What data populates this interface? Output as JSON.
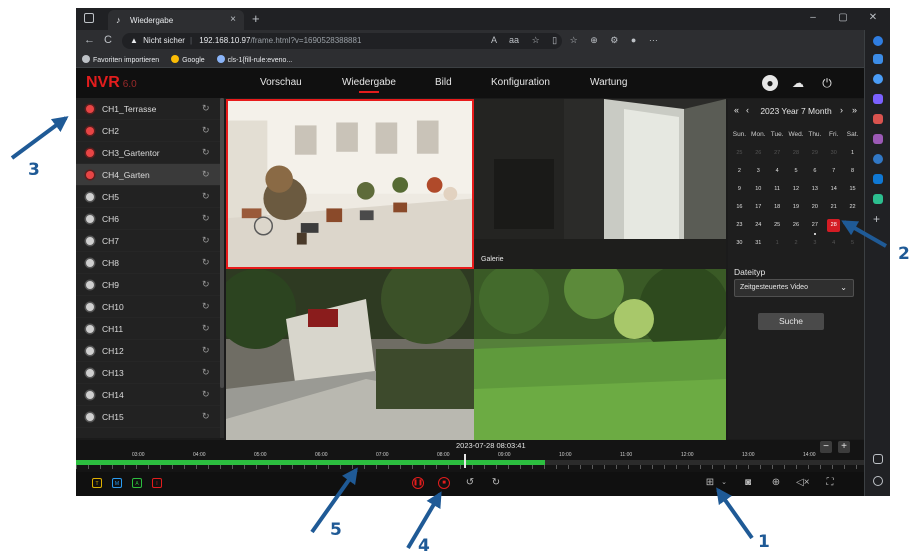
{
  "browser": {
    "tab_title": "Wiedergabe",
    "tab_close": "×",
    "new_tab": "+",
    "window_controls": [
      "–",
      "▢",
      "✕"
    ],
    "nav": [
      "←",
      "C"
    ],
    "security_label": "Nicht sicher",
    "url_host": "192.168.10.97",
    "url_path": "/frame.html?v=1690528388881",
    "icons": [
      "A",
      "aa",
      "☆",
      "▯",
      "☆",
      "⊕",
      "⚙",
      "●",
      "···"
    ],
    "favorites": [
      "Favoriten importieren",
      "Google",
      "cls-1{fill-rule:eveno..."
    ]
  },
  "app": {
    "logo": "NVR",
    "version": "6.0",
    "nav": [
      {
        "label": "Vorschau",
        "active": false
      },
      {
        "label": "Wiedergabe",
        "active": true
      },
      {
        "label": "Bild",
        "active": false
      },
      {
        "label": "Konfiguration",
        "active": false
      },
      {
        "label": "Wartung",
        "active": false
      }
    ],
    "top_icons": [
      "user-icon",
      "cloud-icon",
      "power-icon"
    ]
  },
  "channels": [
    {
      "name": "CH1_Terrasse",
      "recording": true,
      "selected": false
    },
    {
      "name": "CH2",
      "recording": true,
      "selected": false
    },
    {
      "name": "CH3_Gartentor",
      "recording": true,
      "selected": false
    },
    {
      "name": "CH4_Garten",
      "recording": true,
      "selected": true
    },
    {
      "name": "CH5",
      "recording": false,
      "selected": false
    },
    {
      "name": "CH6",
      "recording": false,
      "selected": false
    },
    {
      "name": "CH7",
      "recording": false,
      "selected": false
    },
    {
      "name": "CH8",
      "recording": false,
      "selected": false
    },
    {
      "name": "CH9",
      "recording": false,
      "selected": false
    },
    {
      "name": "CH10",
      "recording": false,
      "selected": false
    },
    {
      "name": "CH11",
      "recording": false,
      "selected": false
    },
    {
      "name": "CH12",
      "recording": false,
      "selected": false
    },
    {
      "name": "CH13",
      "recording": false,
      "selected": false
    },
    {
      "name": "CH14",
      "recording": false,
      "selected": false
    },
    {
      "name": "CH15",
      "recording": false,
      "selected": false
    }
  ],
  "cameras": [
    {
      "label": "",
      "selected": true
    },
    {
      "label": "Galerie",
      "selected": false
    },
    {
      "label": "",
      "selected": false
    },
    {
      "label": "",
      "selected": false
    }
  ],
  "calendar": {
    "nav_prev_year": "«",
    "nav_prev": "‹",
    "nav_next": "›",
    "nav_next_year": "»",
    "header": "2023 Year  7 Month",
    "weekdays": [
      "Sun.",
      "Mon.",
      "Tue.",
      "Wed.",
      "Thu.",
      "Fri.",
      "Sat."
    ],
    "days": [
      {
        "d": "25",
        "muted": true,
        "mark": false,
        "today": false
      },
      {
        "d": "26",
        "muted": true,
        "mark": false,
        "today": false
      },
      {
        "d": "27",
        "muted": true,
        "mark": false,
        "today": false
      },
      {
        "d": "28",
        "muted": true,
        "mark": false,
        "today": false
      },
      {
        "d": "29",
        "muted": true,
        "mark": false,
        "today": false
      },
      {
        "d": "30",
        "muted": true,
        "mark": false,
        "today": false
      },
      {
        "d": "1",
        "muted": false,
        "mark": false,
        "today": false
      },
      {
        "d": "2",
        "muted": false,
        "mark": false,
        "today": false
      },
      {
        "d": "3",
        "muted": false,
        "mark": false,
        "today": false
      },
      {
        "d": "4",
        "muted": false,
        "mark": false,
        "today": false
      },
      {
        "d": "5",
        "muted": false,
        "mark": false,
        "today": false
      },
      {
        "d": "6",
        "muted": false,
        "mark": false,
        "today": false
      },
      {
        "d": "7",
        "muted": false,
        "mark": false,
        "today": false
      },
      {
        "d": "8",
        "muted": false,
        "mark": false,
        "today": false
      },
      {
        "d": "9",
        "muted": false,
        "mark": false,
        "today": false
      },
      {
        "d": "10",
        "muted": false,
        "mark": false,
        "today": false
      },
      {
        "d": "11",
        "muted": false,
        "mark": false,
        "today": false
      },
      {
        "d": "12",
        "muted": false,
        "mark": false,
        "today": false
      },
      {
        "d": "13",
        "muted": false,
        "mark": false,
        "today": false
      },
      {
        "d": "14",
        "muted": false,
        "mark": false,
        "today": false
      },
      {
        "d": "15",
        "muted": false,
        "mark": false,
        "today": false
      },
      {
        "d": "16",
        "muted": false,
        "mark": false,
        "today": false
      },
      {
        "d": "17",
        "muted": false,
        "mark": false,
        "today": false
      },
      {
        "d": "18",
        "muted": false,
        "mark": false,
        "today": false
      },
      {
        "d": "19",
        "muted": false,
        "mark": false,
        "today": false
      },
      {
        "d": "20",
        "muted": false,
        "mark": false,
        "today": false
      },
      {
        "d": "21",
        "muted": false,
        "mark": false,
        "today": false
      },
      {
        "d": "22",
        "muted": false,
        "mark": false,
        "today": false
      },
      {
        "d": "23",
        "muted": false,
        "mark": false,
        "today": false
      },
      {
        "d": "24",
        "muted": false,
        "mark": false,
        "today": false
      },
      {
        "d": "25",
        "muted": false,
        "mark": false,
        "today": false
      },
      {
        "d": "26",
        "muted": false,
        "mark": false,
        "today": false
      },
      {
        "d": "27",
        "muted": false,
        "mark": true,
        "today": false
      },
      {
        "d": "28",
        "muted": false,
        "mark": false,
        "today": true
      },
      {
        "d": "29",
        "muted": false,
        "mark": false,
        "today": false
      },
      {
        "d": "30",
        "muted": false,
        "mark": false,
        "today": false
      },
      {
        "d": "31",
        "muted": false,
        "mark": false,
        "today": false
      },
      {
        "d": "1",
        "muted": true,
        "mark": false,
        "today": false
      },
      {
        "d": "2",
        "muted": true,
        "mark": false,
        "today": false
      },
      {
        "d": "3",
        "muted": true,
        "mark": false,
        "today": false
      },
      {
        "d": "4",
        "muted": true,
        "mark": false,
        "today": false
      },
      {
        "d": "5",
        "muted": true,
        "mark": false,
        "today": false
      }
    ],
    "file_type_label": "Dateityp",
    "file_type_value": "Zeitgesteuertes Video",
    "search_button": "Suche"
  },
  "timeline": {
    "current_time": "2023-07-28 08:03:41",
    "hours": [
      "03:00",
      "04:00",
      "05:00",
      "06:00",
      "07:00",
      "08:00",
      "09:00",
      "10:00",
      "11:00",
      "12:00",
      "13:00",
      "14:00"
    ],
    "recorded_until_fraction": 0.595,
    "zoom_out": "−",
    "zoom_in": "+"
  },
  "controls": {
    "record_types": [
      {
        "label": "T",
        "color": "#e0b000"
      },
      {
        "label": "M",
        "color": "#2a9df4"
      },
      {
        "label": "A",
        "color": "#2cbe3f"
      },
      {
        "label": "I",
        "color": "#e21d1d"
      }
    ],
    "playback": [
      "pause-icon",
      "stop-icon",
      "rewind-icon",
      "forward-icon"
    ],
    "right": [
      "layout-grid-icon",
      "snapshot-icon",
      "digital-zoom-icon",
      "mute-icon",
      "fullscreen-icon"
    ]
  },
  "annotations": [
    "1",
    "2",
    "3",
    "4",
    "5"
  ],
  "colors": {
    "accent": "#e21d1d",
    "record_green": "#2cbe3f",
    "annotation_blue": "#1f5a96"
  }
}
